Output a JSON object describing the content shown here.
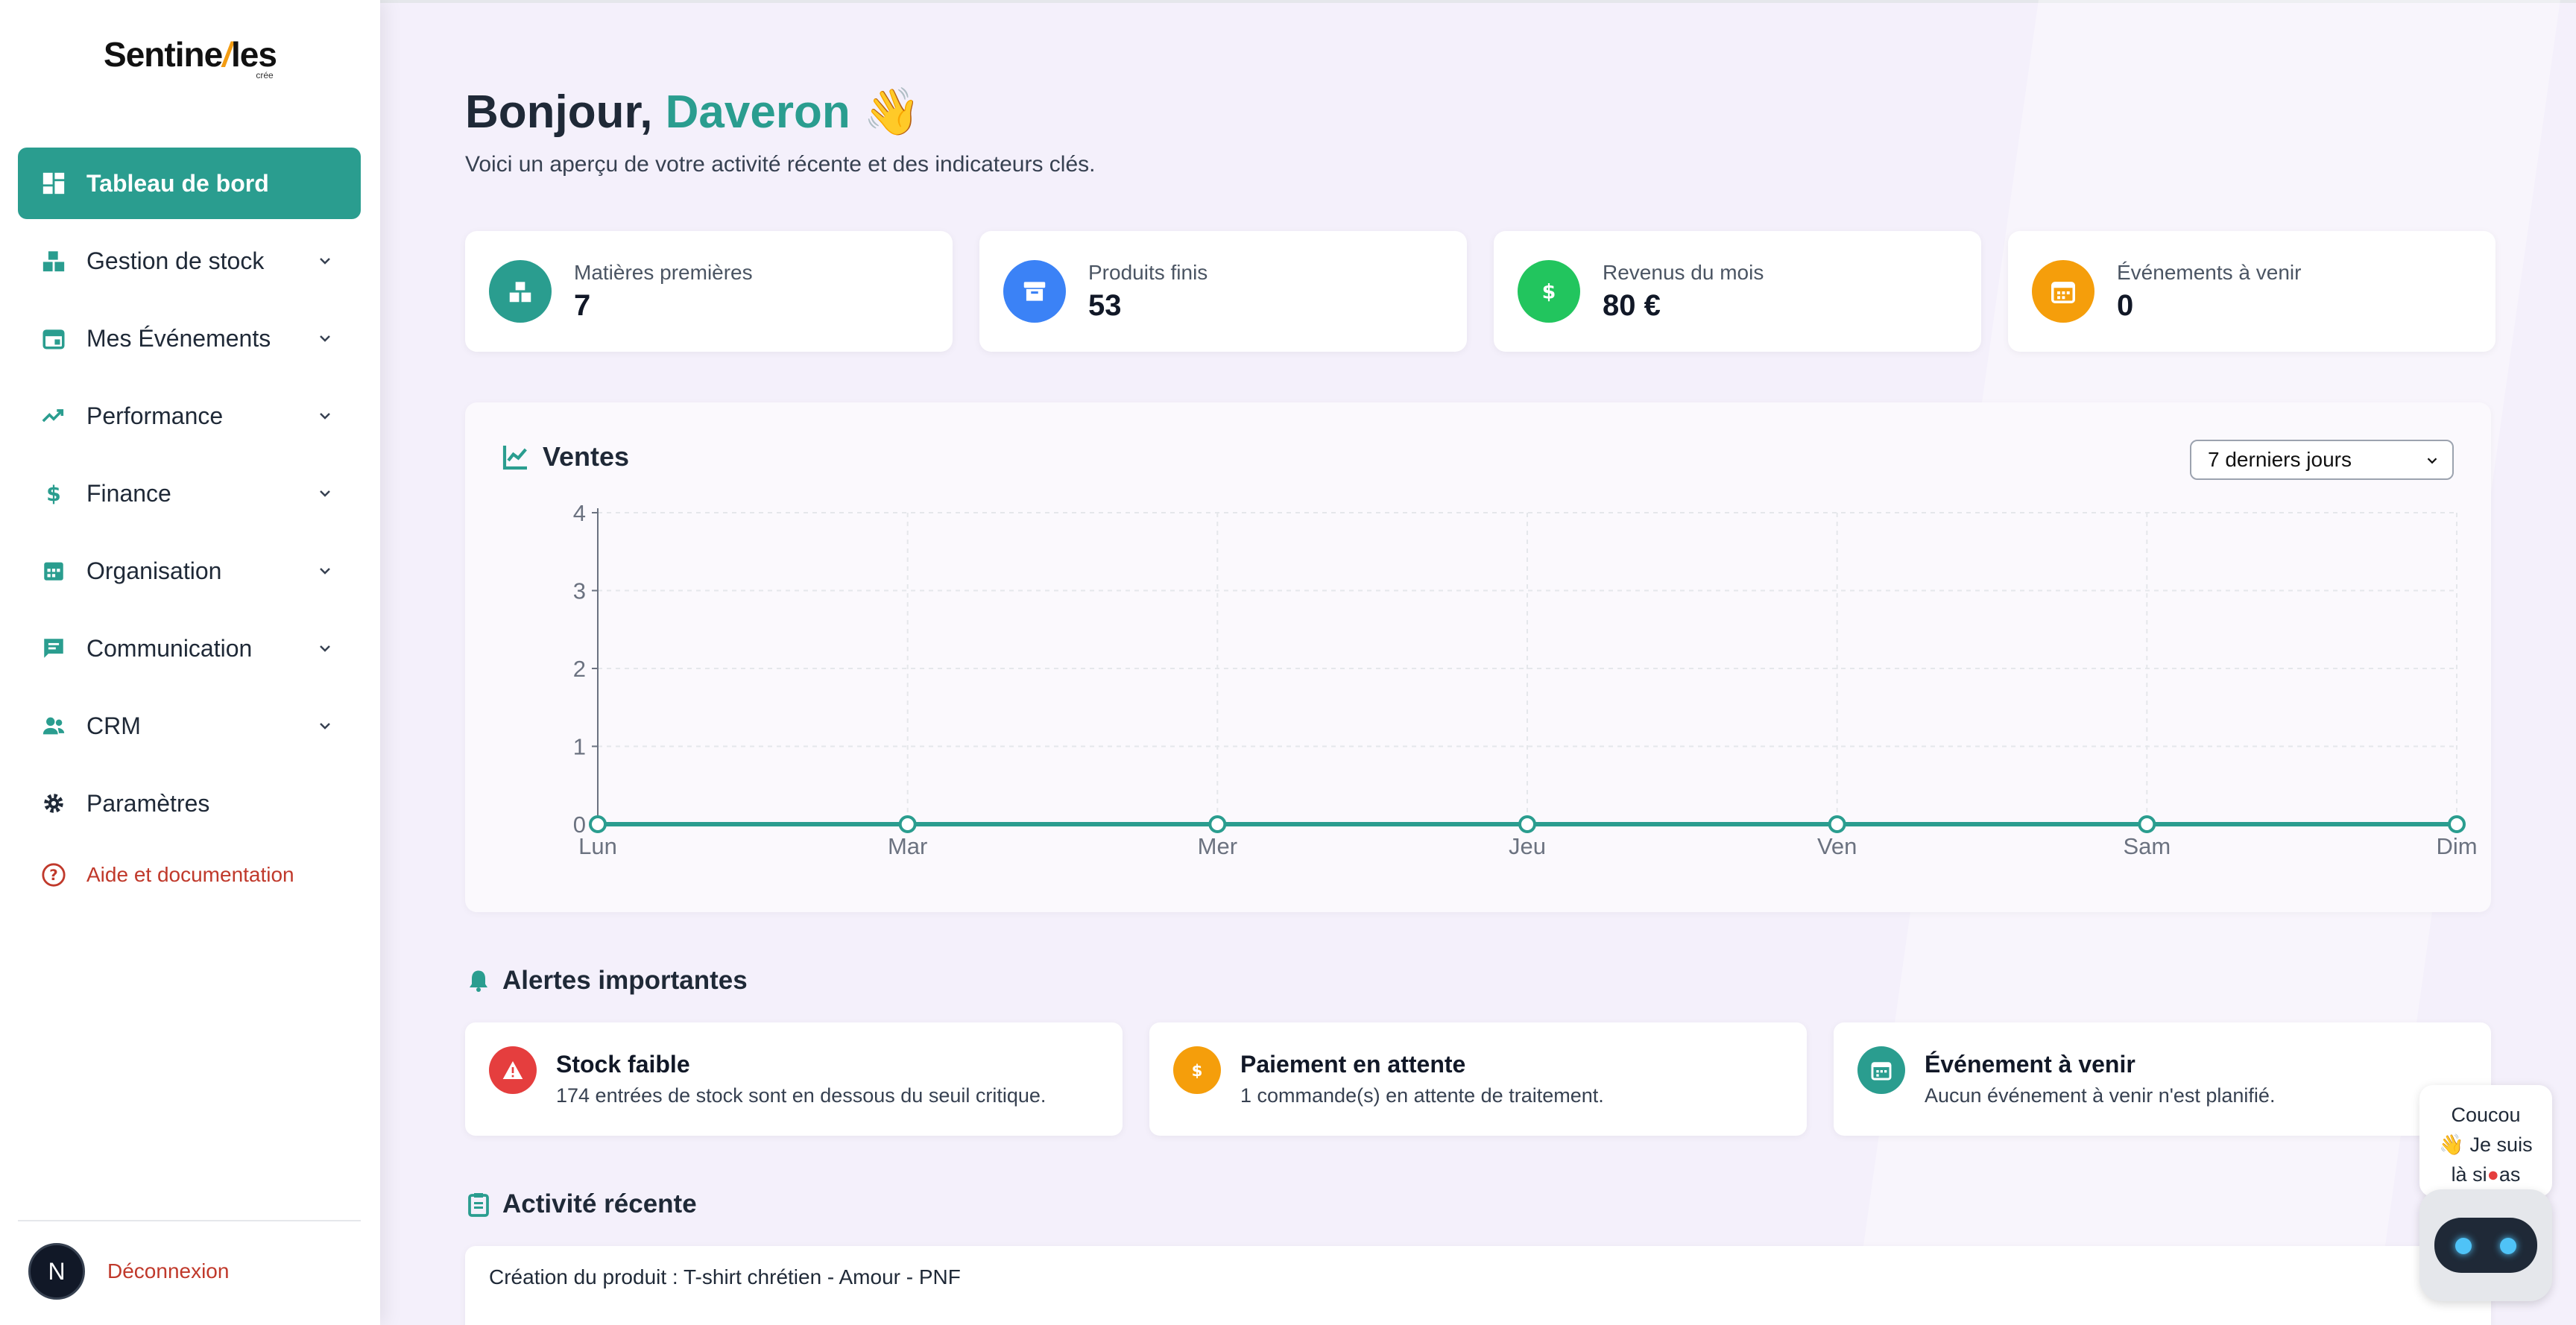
{
  "brand": {
    "name": "Sentine",
    "name_suffix": "les",
    "slash": "/",
    "sub": "crée"
  },
  "sidebar": {
    "items": [
      {
        "label": "Tableau de bord",
        "icon": "dashboard-icon",
        "active": true
      },
      {
        "label": "Gestion de stock",
        "icon": "boxes-icon"
      },
      {
        "label": "Mes Événements",
        "icon": "calendar-icon"
      },
      {
        "label": "Performance",
        "icon": "trending-up-icon"
      },
      {
        "label": "Finance",
        "icon": "dollar-icon"
      },
      {
        "label": "Organisation",
        "icon": "calendar-grid-icon"
      },
      {
        "label": "Communication",
        "icon": "chat-icon"
      },
      {
        "label": "CRM",
        "icon": "users-icon"
      },
      {
        "label": "Paramètres",
        "icon": "gear-icon"
      }
    ],
    "help_label": "Aide et documentation",
    "avatar_letter": "N",
    "logout_label": "Déconnexion"
  },
  "header": {
    "greeting": "Bonjour,",
    "name": "Daveron",
    "wave": "👋",
    "subtitle": "Voici un aperçu de votre activité récente et des indicateurs clés."
  },
  "stats": [
    {
      "label": "Matières premières",
      "value": "7",
      "color": "#2a9d8f",
      "icon": "boxes-icon"
    },
    {
      "label": "Produits finis",
      "value": "53",
      "color": "#3b82f6",
      "icon": "archive-icon"
    },
    {
      "label": "Revenus du mois",
      "value": "80 €",
      "color": "#22c55e",
      "icon": "dollar-icon"
    },
    {
      "label": "Événements à venir",
      "value": "0",
      "color": "#f59e0b",
      "icon": "calendar-icon"
    }
  ],
  "sales": {
    "title": "Ventes",
    "range_selected": "7 derniers jours"
  },
  "chart_data": {
    "type": "line",
    "title": "Ventes",
    "categories": [
      "Lun",
      "Mar",
      "Mer",
      "Jeu",
      "Ven",
      "Sam",
      "Dim"
    ],
    "values": [
      0,
      0,
      0,
      0,
      0,
      0,
      0
    ],
    "y_ticks": [
      "0",
      "1",
      "2",
      "3",
      "4"
    ],
    "ylim": [
      0,
      4
    ],
    "grid": true,
    "color": "#2a9d8f"
  },
  "alerts": {
    "title": "Alertes importantes",
    "items": [
      {
        "title": "Stock faible",
        "desc": "174 entrées de stock sont en dessous du seuil critique.",
        "color": "#e53e3e",
        "icon": "warning-icon"
      },
      {
        "title": "Paiement en attente",
        "desc": "1 commande(s) en attente de traitement.",
        "color": "#f59e0b",
        "icon": "dollar-icon"
      },
      {
        "title": "Événement à venir",
        "desc": "Aucun événement à venir n'est planifié.",
        "color": "#2a9d8f",
        "icon": "calendar-icon"
      }
    ]
  },
  "activity": {
    "title": "Activité récente",
    "items": [
      "Création du produit : T-shirt chrétien - Amour - PNF"
    ]
  },
  "assistant": {
    "line1": "Coucou",
    "line2": "👋 Je suis",
    "line3": "là si",
    "line3_end": "as"
  }
}
